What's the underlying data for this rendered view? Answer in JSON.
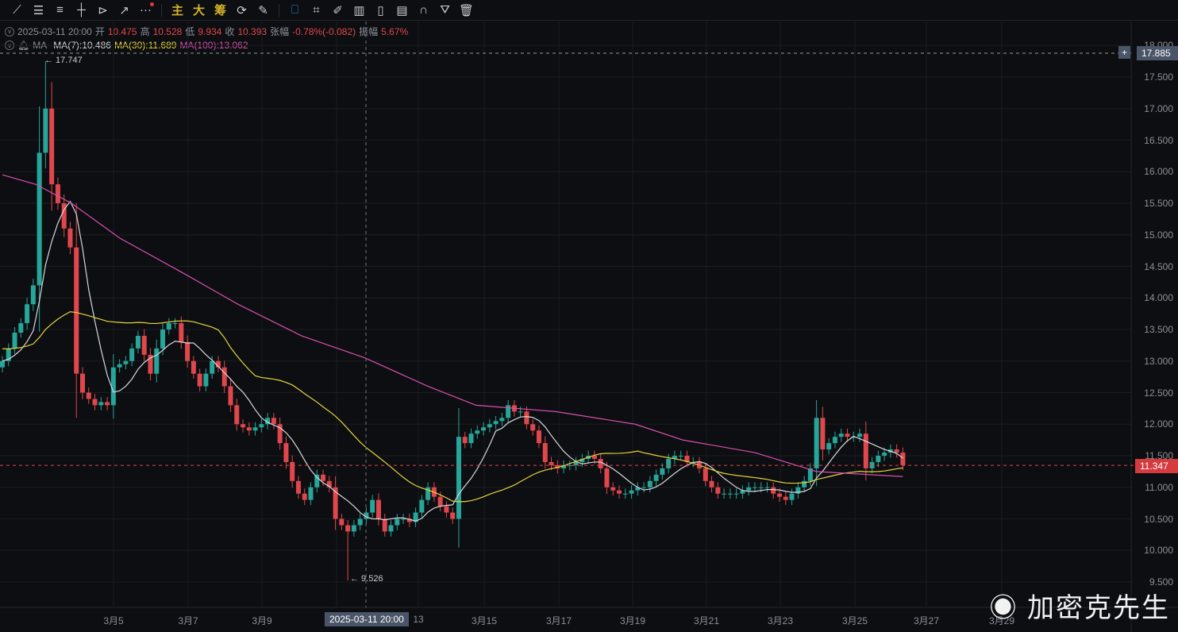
{
  "toolbar": {
    "tools": [
      {
        "name": "trend-line-icon",
        "glyph": "⟋"
      },
      {
        "name": "parallel-lines-icon",
        "glyph": "☰"
      },
      {
        "name": "horizontal-lines-icon",
        "glyph": "≡"
      },
      {
        "name": "crosshair-line-icon",
        "glyph": "┼"
      },
      {
        "name": "fib-triangle-icon",
        "glyph": "⊳"
      },
      {
        "name": "arrow-line-icon",
        "glyph": "↗"
      },
      {
        "name": "more-icon",
        "glyph": "···"
      }
    ],
    "cn_tools": [
      "主",
      "大",
      "筹"
    ],
    "tools2": [
      {
        "name": "replay-icon",
        "glyph": "⟳"
      },
      {
        "name": "draw-tool-icon",
        "glyph": "✎"
      },
      {
        "name": "bookmark-icon",
        "glyph": "⎕"
      },
      {
        "name": "ruler-icon",
        "glyph": "⌗"
      },
      {
        "name": "pen-icon",
        "glyph": "✐"
      },
      {
        "name": "candles-icon",
        "glyph": "▥"
      },
      {
        "name": "phone-icon",
        "glyph": "▯"
      },
      {
        "name": "note-icon",
        "glyph": "▤"
      },
      {
        "name": "magnet-icon",
        "glyph": "∩"
      },
      {
        "name": "filter-icon",
        "glyph": "⛛"
      },
      {
        "name": "trash-icon",
        "glyph": "🗑"
      }
    ]
  },
  "ohlc_line": {
    "datetime": "2025-03-11 20:00",
    "open_label": "开",
    "open": "10.475",
    "high_label": "高",
    "high": "10.528",
    "low_label": "低",
    "low": "9.934",
    "close_label": "收",
    "close": "10.393",
    "change_label": "张幅",
    "change": "-0.78%(-0.082)",
    "amp_label": "振幅",
    "amp": "5.67%"
  },
  "ma_line": {
    "label": "MA",
    "ma7": "MA(7):10.486",
    "ma30": "MA(30):11.689",
    "ma100": "MA(100):13.062"
  },
  "colors": {
    "up": "#26a69a",
    "down": "#e0474c",
    "ma7": "#d5d8dd",
    "ma30": "#e6d53a",
    "ma100": "#d84fb0",
    "bg": "#0d0e11"
  },
  "annotations": {
    "high": "← 17.747",
    "low": "← 9.526",
    "crosshair_price": "17.885",
    "last_price": "11.347",
    "crosshair_time": "2025-03-11 20:00"
  },
  "watermark": "加密克先生",
  "chart_data": {
    "type": "candlestick",
    "interval": "4h",
    "ylim": [
      9.3,
      18.1
    ],
    "yticks": [
      "18.000",
      "17.500",
      "17.000",
      "16.500",
      "16.000",
      "15.500",
      "15.000",
      "14.500",
      "14.000",
      "13.500",
      "13.000",
      "12.500",
      "12.000",
      "11.500",
      "11.000",
      "10.500",
      "10.000",
      "9.500"
    ],
    "xticks": [
      "3月5",
      "3月7",
      "3月9",
      "3月11",
      "13",
      "3月15",
      "3月17",
      "3月19",
      "3月21",
      "3月23",
      "3月25",
      "3月27",
      "3月29"
    ],
    "first_open": 12.9,
    "close": [
      13.0,
      13.2,
      13.45,
      13.6,
      13.9,
      14.2,
      16.3,
      17.0,
      15.8,
      15.5,
      15.1,
      14.8,
      12.8,
      12.5,
      12.4,
      12.3,
      12.35,
      12.3,
      12.9,
      12.95,
      13.0,
      13.2,
      13.4,
      13.1,
      12.8,
      13.2,
      13.5,
      13.6,
      13.6,
      13.3,
      13.0,
      12.8,
      12.6,
      12.8,
      13.0,
      12.9,
      12.6,
      12.3,
      12.0,
      11.95,
      11.9,
      11.95,
      12.0,
      12.1,
      12.0,
      11.7,
      11.4,
      11.1,
      10.9,
      10.8,
      11.0,
      11.2,
      11.1,
      11.0,
      10.5,
      10.4,
      10.3,
      10.4,
      10.5,
      10.6,
      10.8,
      10.5,
      10.3,
      10.4,
      10.5,
      10.5,
      10.45,
      10.6,
      10.8,
      11.0,
      10.85,
      10.7,
      10.6,
      10.5,
      11.8,
      11.7,
      11.85,
      11.9,
      11.95,
      12.0,
      12.05,
      12.1,
      12.3,
      12.2,
      12.2,
      12.0,
      11.9,
      11.7,
      11.4,
      11.35,
      11.3,
      11.35,
      11.35,
      11.4,
      11.45,
      11.5,
      11.45,
      11.3,
      11.0,
      10.95,
      10.9,
      10.9,
      10.95,
      11.0,
      11.0,
      11.1,
      11.2,
      11.3,
      11.45,
      11.5,
      11.5,
      11.4,
      11.4,
      11.3,
      11.1,
      11.0,
      10.9,
      10.9,
      10.9,
      10.9,
      10.95,
      11.0,
      11.0,
      11.0,
      11.0,
      10.9,
      10.85,
      10.8,
      10.9,
      11.0,
      11.1,
      11.3,
      12.1,
      11.6,
      11.7,
      11.8,
      11.85,
      11.8,
      11.8,
      11.85,
      11.3,
      11.4,
      11.5,
      11.55,
      11.6,
      11.55,
      11.35
    ],
    "ma100_points": [
      [
        0,
        15.95
      ],
      [
        5.4,
        15.8
      ],
      [
        11.2,
        15.5
      ],
      [
        19,
        14.95
      ],
      [
        29.2,
        14.4
      ],
      [
        38.2,
        13.9
      ],
      [
        48.5,
        13.4
      ],
      [
        58.8,
        13.05
      ],
      [
        69,
        12.6
      ],
      [
        76.8,
        12.3
      ],
      [
        89.7,
        12.2
      ],
      [
        102.6,
        12.0
      ],
      [
        110.3,
        11.75
      ],
      [
        122,
        11.55
      ],
      [
        132,
        11.25
      ],
      [
        146,
        11.17
      ]
    ]
  }
}
